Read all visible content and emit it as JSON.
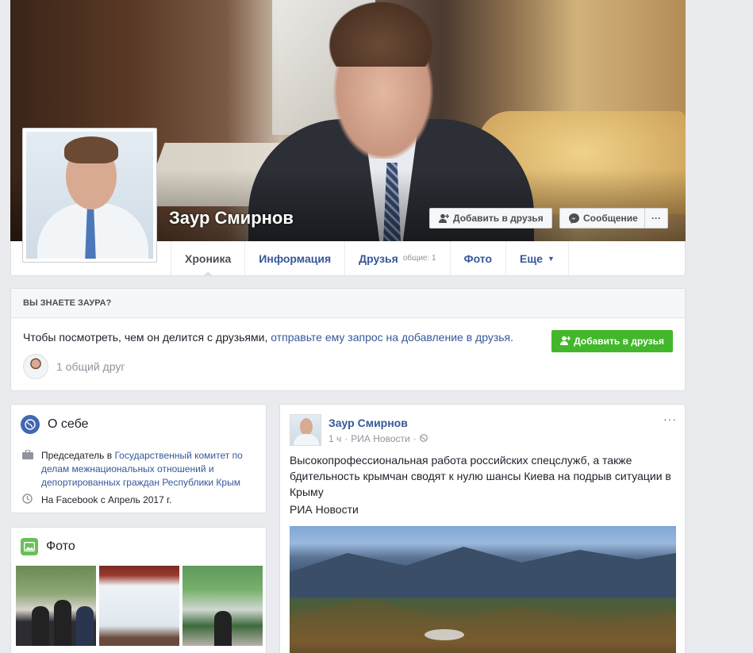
{
  "profile": {
    "name": "Заур Смирнов",
    "add_friend_label": "Добавить в друзья",
    "message_label": "Сообщение",
    "more_label": "···"
  },
  "tabs": [
    {
      "label": "Хроника"
    },
    {
      "label": "Информация"
    },
    {
      "label": "Друзья",
      "sub": "общие: 1"
    },
    {
      "label": "Фото"
    },
    {
      "label": "Еще"
    }
  ],
  "know": {
    "heading": "ВЫ ЗНАЕТЕ ЗАУРА?",
    "text_prefix": "Чтобы посмотреть, чем он делится с друзьями, ",
    "link_text": "отправьте ему запрос на добавление в друзья.",
    "button_label": "Добавить в друзья",
    "mutual_label": "1 общий друг"
  },
  "about": {
    "title": "О себе",
    "job_prefix": "Председатель в ",
    "job_link": "Государственный комитет по делам межнациональных отношений и депортированных граждан Республики Крым",
    "joined": "На Facebook с Апрель 2017 г."
  },
  "photos": {
    "title": "Фото"
  },
  "post": {
    "author": "Заур Смирнов",
    "time": "1 ч",
    "source_meta": "РИА Новости",
    "text": "Высокопрофессиональная работа российских спецслужб, а также бдительность крымчан сводят к нулю шансы Киева на подрыв ситуации в Крыму",
    "source": "РИА Новости",
    "menu": "···"
  },
  "colors": {
    "link": "#365899",
    "green_button": "#42b72a",
    "page_bg": "#e9ebee"
  },
  "icons": {
    "add_friend": "add-friend-icon",
    "messenger": "messenger-icon",
    "globe": "globe-icon",
    "briefcase": "briefcase-icon",
    "clock": "clock-icon",
    "photo": "photo-icon"
  }
}
